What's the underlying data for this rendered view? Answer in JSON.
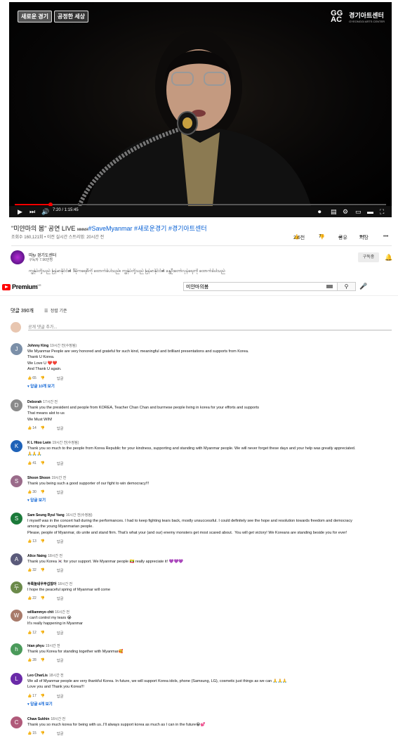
{
  "video": {
    "tag1": "새로운 경기",
    "tag2": "공정한 세상",
    "logo_mark": "GG AC",
    "logo_name": "경기아트센터",
    "logo_sub": "GYEONGGI ARTS CENTER",
    "time": "7:20 / 1:15:45",
    "progress_fraction": 0.097
  },
  "info": {
    "title_main": "\"미얀마의 봄\" 공연 LIVE ",
    "title_small": "мммя",
    "title_hashtags": "#SaveMyanmar #새로운경기 #경기아트센터",
    "meta": "조회수 160,121회 • 이전 실시간 스트리밍: 20시간 전",
    "likes": "2.6천",
    "dislikes": "7",
    "share": "공유",
    "save": "저장",
    "more": "•••"
  },
  "channel": {
    "name": "따tv 경기도센터",
    "subs": "구독자 7.96만명",
    "subscribe": "구독중",
    "description": "ကျွန်ုပ်တို့သည် မြန်မာနိုင်ငံ၏ ဒီမိုကရေစီကို ထောက်ခံပါသည်။ ကျွန်ုပ်တို့သည် မြန်မာနိုင်ငံ၏ နွေဦးတော်လှန်ရေးကို ထောက်ခံပါသည်"
  },
  "topbar": {
    "brand": "Premium",
    "region": "KR",
    "search_value": "미얀마의봄"
  },
  "comments_header": {
    "count": "댓글 390개",
    "sort": "정렬 기준",
    "add_placeholder": "공개 댓글 추가..."
  },
  "reply_label": "답글",
  "comments": [
    {
      "author": "Johnny King",
      "time": "19시간 전(수정됨)",
      "avatar": "J",
      "avatar_color": "#7b8fa8",
      "text": "We Myanmar People are very honored and grateful for such kind, meaningful and brilliant presentations and supports from Korea.\nThank U Korea.\nWe Love U ❤️❤️\nAnd Thank U again.",
      "likes": "65",
      "more": "▾  답글 10개 보기"
    },
    {
      "author": "Deborah",
      "time": "17시간 전",
      "avatar": "D",
      "avatar_color": "#8a8a8a",
      "text": "Thank you the president and people from KOREA, Teacher Chan Chan and burmese people living in korea for your efforts and supports\nThat means alot to us\nWe Must WIN!",
      "likes": "14",
      "more": ""
    },
    {
      "author": "K L Htoo Lwin",
      "time": "19시간 전(수정됨)",
      "avatar": "K",
      "avatar_color": "#1e62b8",
      "text": "Thank you so much to the people from Korea Republic for your kindness, supporting and standing with Myanmar people. We will never forget these days and your help was greatly appreciated.\n🙏🙏🙏",
      "likes": "41",
      "more": ""
    },
    {
      "author": "Shoon Shoon",
      "time": "19시간 전",
      "avatar": "S",
      "avatar_color": "#9a6b8a",
      "text": "Thank you being such a good supporter of our fight to win democracy!!!",
      "likes": "30",
      "more": "▾  답글 보기"
    },
    {
      "author": "Sam Seung Ryul Yang",
      "time": "16시간 전(수정됨)",
      "avatar": "S",
      "avatar_color": "#1b7a3a",
      "text": "I myself was in the concert hall during the performances. I had to keep fighting tears back, mostly unsuccessful. I could definitely see the hope and resolution towards freedom and democracy\namong the young Myanmarian people.\nPlease, people of Myanmar, do unite and stand firm. That's what your (and our) enemy monsters get most scared about.  You will get victory! We Koreans are standing beside you for ever!",
      "likes": "13",
      "more": ""
    },
    {
      "author": "Alice Naing",
      "time": "18시간 전",
      "avatar": "A",
      "avatar_color": "#5a5a7a",
      "text": "Thank you Korea 🇰🇷 for your support. We Myanmar people 🇲🇲 really appreciate it! 💜💜💜",
      "likes": "32",
      "more": ""
    },
    {
      "author": "두룩눌네우무섭잖아",
      "time": "18시간 전",
      "avatar": "두",
      "avatar_color": "#6b8a4a",
      "text": "I hope the peaceful spring of Myanmar will come",
      "likes": "22",
      "more": ""
    },
    {
      "author": "williammyo chit",
      "time": "16시간 전",
      "avatar": "W",
      "avatar_color": "#a87a6a",
      "text": "I can't control my tears 😭\nIt's really happening in Myanmar",
      "likes": "12",
      "more": ""
    },
    {
      "author": "htan phyu",
      "time": "19시간 전",
      "avatar": "h",
      "avatar_color": "#4a9a5a",
      "text": "Thank you Korea for standing together with Myanmar🥰",
      "likes": "28",
      "more": ""
    },
    {
      "author": "Leo CharLis",
      "time": "18시간 전",
      "avatar": "L",
      "avatar_color": "#6a2aa8",
      "text": "We all of Myanmar people are very thankful Korea. In future, we will support Korea idols, phone (Samsung, LG), cosmetic just things as we can 🙏🙏🙏\nLove you and Thank you Korea!!!",
      "likes": "17",
      "more": "▾  답글 4개 보기"
    },
    {
      "author": "Chaw Sukhin",
      "time": "18시간 전",
      "avatar": "C",
      "avatar_color": "#b05a7a",
      "text": "Thank you so much korea for being with us..I'll always support korea as much as I can in the future😭💕",
      "likes": "15",
      "more": ""
    }
  ]
}
